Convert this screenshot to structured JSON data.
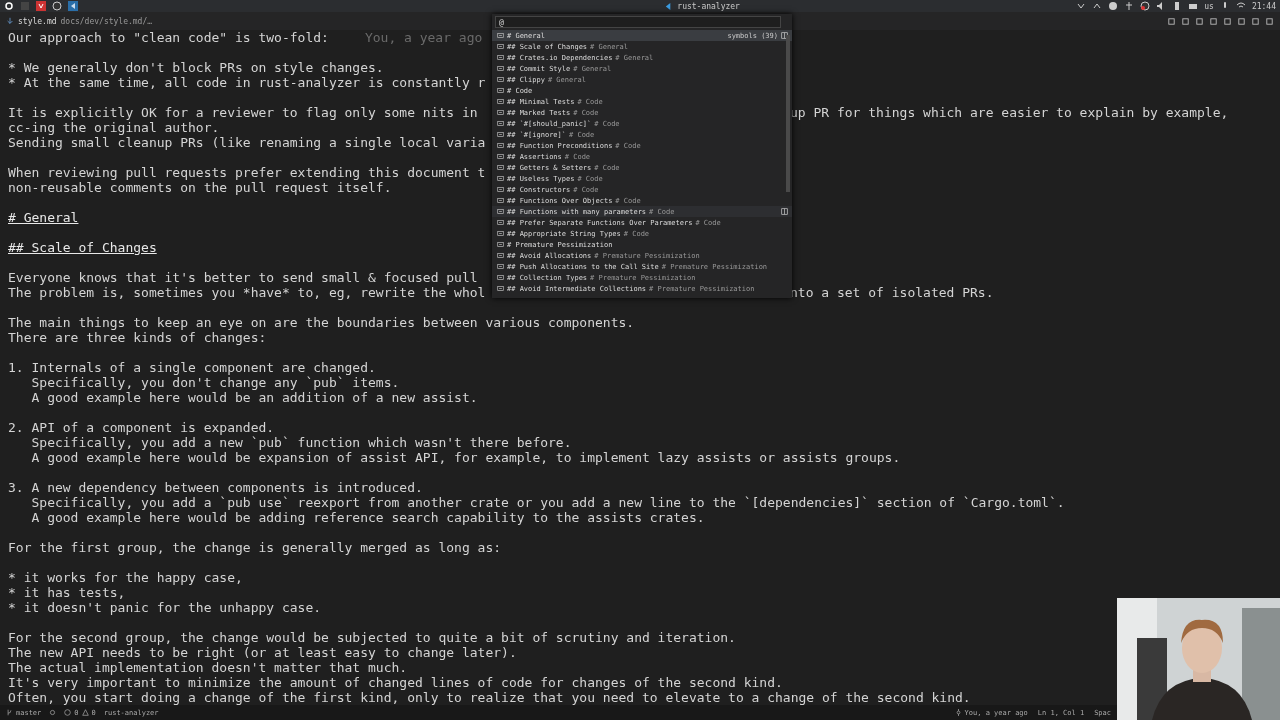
{
  "top_bar": {
    "app_title": "rust-analyzer",
    "keyboard": "us",
    "clock": "21:44"
  },
  "tab": {
    "label": "style.md",
    "path": "docs/dev/style.md/…"
  },
  "quick_open": {
    "query": "@",
    "count_label": "symbols (39)",
    "items": [
      {
        "label": "# General",
        "selected": true,
        "hovered": false
      },
      {
        "label": "## Scale of Changes",
        "detail": "# General",
        "selected": false,
        "hovered": false
      },
      {
        "label": "## Crates.io Dependencies",
        "detail": "# General",
        "selected": false,
        "hovered": false
      },
      {
        "label": "## Commit Style",
        "detail": "# General",
        "selected": false,
        "hovered": false
      },
      {
        "label": "## Clippy",
        "detail": "# General",
        "selected": false,
        "hovered": false
      },
      {
        "label": "# Code",
        "selected": false,
        "hovered": false
      },
      {
        "label": "## Minimal Tests",
        "detail": "# Code",
        "selected": false,
        "hovered": false
      },
      {
        "label": "## Marked Tests",
        "detail": "# Code",
        "selected": false,
        "hovered": false
      },
      {
        "label": "## `#[should_panic]`",
        "detail": "# Code",
        "selected": false,
        "hovered": false
      },
      {
        "label": "## `#[ignore]`",
        "detail": "# Code",
        "selected": false,
        "hovered": false
      },
      {
        "label": "## Function Preconditions",
        "detail": "# Code",
        "selected": false,
        "hovered": false
      },
      {
        "label": "## Assertions",
        "detail": "# Code",
        "selected": false,
        "hovered": false
      },
      {
        "label": "## Getters & Setters",
        "detail": "# Code",
        "selected": false,
        "hovered": false
      },
      {
        "label": "## Useless Types",
        "detail": "# Code",
        "selected": false,
        "hovered": false
      },
      {
        "label": "## Constructors",
        "detail": "# Code",
        "selected": false,
        "hovered": false
      },
      {
        "label": "## Functions Over Objects",
        "detail": "# Code",
        "selected": false,
        "hovered": false
      },
      {
        "label": "## Functions with many parameters",
        "detail": "# Code",
        "selected": false,
        "hovered": true
      },
      {
        "label": "## Prefer Separate Functions Over Parameters",
        "detail": "# Code",
        "selected": false,
        "hovered": false
      },
      {
        "label": "## Appropriate String Types",
        "detail": "# Code",
        "selected": false,
        "hovered": false
      },
      {
        "label": "# Premature Pessimization",
        "selected": false,
        "hovered": false
      },
      {
        "label": "## Avoid Allocations",
        "detail": "# Premature Pessimization",
        "selected": false,
        "hovered": false
      },
      {
        "label": "## Push Allocations to the Call Site",
        "detail": "# Premature Pessimization",
        "selected": false,
        "hovered": false
      },
      {
        "label": "## Collection Types",
        "detail": "# Premature Pessimization",
        "selected": false,
        "hovered": false
      },
      {
        "label": "## Avoid Intermediate Collections",
        "detail": "# Premature Pessimization",
        "selected": false,
        "hovered": false
      }
    ]
  },
  "editor_lines": [
    {
      "kind": "text",
      "text": "Our approach to \"clean code\" is two-fold:",
      "blame": "You, a year ago"
    },
    {
      "kind": "blank"
    },
    {
      "kind": "text",
      "text": "* We generally don't block PRs on style changes."
    },
    {
      "kind": "text",
      "text": "* At the same time, all code in rust-analyzer is constantly r"
    },
    {
      "kind": "blank"
    },
    {
      "kind": "text",
      "text": "It is explicitly OK for a reviewer to flag only some nits in",
      "right": "up PR for things which are easier to explain by example,"
    },
    {
      "kind": "text",
      "text": "cc-ing the original author."
    },
    {
      "kind": "text",
      "text": "Sending small cleanup PRs (like renaming a single local varia"
    },
    {
      "kind": "blank"
    },
    {
      "kind": "text",
      "text": "When reviewing pull requests prefer extending this document t"
    },
    {
      "kind": "text",
      "text": "non-reusable comments on the pull request itself."
    },
    {
      "kind": "blank"
    },
    {
      "kind": "heading",
      "text": "# General"
    },
    {
      "kind": "blank"
    },
    {
      "kind": "heading",
      "text": "## Scale of Changes"
    },
    {
      "kind": "blank"
    },
    {
      "kind": "text",
      "text": "Everyone knows that it's better to send small & focused pull"
    },
    {
      "kind": "text",
      "text": "The problem is, sometimes you *have* to, eg, rewrite the whol",
      "right": "nto a set of isolated PRs."
    },
    {
      "kind": "blank"
    },
    {
      "kind": "text",
      "text": "The main things to keep an eye on are the boundaries between various components."
    },
    {
      "kind": "text",
      "text": "There are three kinds of changes:"
    },
    {
      "kind": "blank"
    },
    {
      "kind": "text",
      "text": "1. Internals of a single component are changed."
    },
    {
      "kind": "text",
      "text": "   Specifically, you don't change any `pub` items."
    },
    {
      "kind": "text",
      "text": "   A good example here would be an addition of a new assist."
    },
    {
      "kind": "blank"
    },
    {
      "kind": "text",
      "text": "2. API of a component is expanded."
    },
    {
      "kind": "text",
      "text": "   Specifically, you add a new `pub` function which wasn't there before."
    },
    {
      "kind": "text",
      "text": "   A good example here would be expansion of assist API, for example, to implement lazy assists or assists groups."
    },
    {
      "kind": "blank"
    },
    {
      "kind": "text",
      "text": "3. A new dependency between components is introduced."
    },
    {
      "kind": "text",
      "text": "   Specifically, you add a `pub use` reexport from another crate or you add a new line to the `[dependencies]` section of `Cargo.toml`."
    },
    {
      "kind": "text",
      "text": "   A good example here would be adding reference search capability to the assists crates."
    },
    {
      "kind": "blank"
    },
    {
      "kind": "text",
      "text": "For the first group, the change is generally merged as long as:"
    },
    {
      "kind": "blank"
    },
    {
      "kind": "text",
      "text": "* it works for the happy case,"
    },
    {
      "kind": "text",
      "text": "* it has tests,"
    },
    {
      "kind": "text",
      "text": "* it doesn't panic for the unhappy case."
    },
    {
      "kind": "blank"
    },
    {
      "kind": "text",
      "text": "For the second group, the change would be subjected to quite a bit of scrutiny and iteration."
    },
    {
      "kind": "text",
      "text": "The new API needs to be right (or at least easy to change later)."
    },
    {
      "kind": "text",
      "text": "The actual implementation doesn't matter that much."
    },
    {
      "kind": "text",
      "text": "It's very important to minimize the amount of changed lines of code for changes of the second kind."
    },
    {
      "kind": "text",
      "text": "Often, you start doing a change of the first kind, only to realize that you need to elevate to a change of the second kind."
    }
  ],
  "status_bar": {
    "branch": "master",
    "errors": "0",
    "warnings": "0",
    "extension": "rust-analyzer",
    "blame": "You, a year ago",
    "position": "Ln 1, Col 1",
    "indent": "Spac"
  }
}
